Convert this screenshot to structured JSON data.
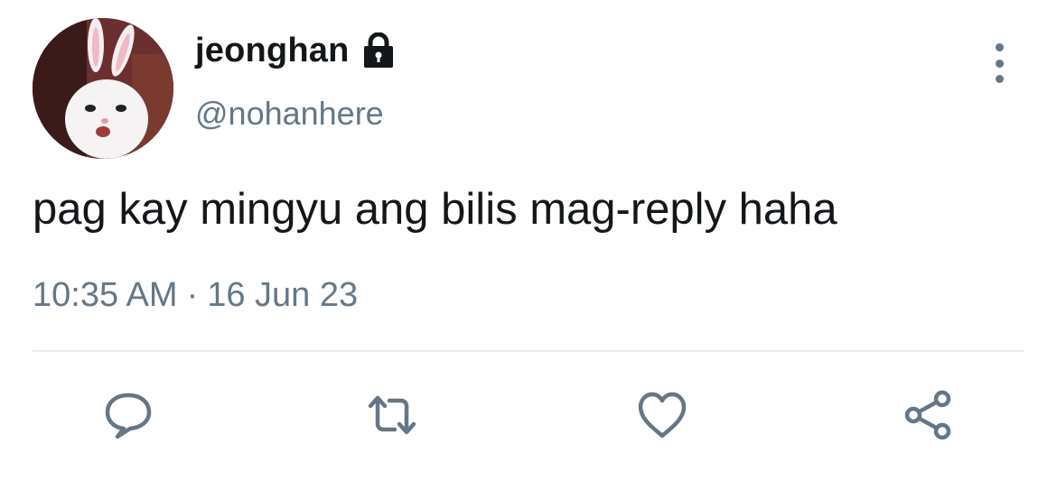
{
  "tweet": {
    "display_name": "jeonghan",
    "handle": "@nohanhere",
    "text": "pag kay mingyu ang bilis mag-reply haha",
    "time": "10:35 AM",
    "separator": "·",
    "date": "16 Jun 23",
    "protected": true
  },
  "icons": {
    "lock": "lock-icon",
    "more": "more-vertical-icon",
    "reply": "reply-icon",
    "retweet": "retweet-icon",
    "like": "heart-icon",
    "share": "share-icon"
  },
  "colors": {
    "text": "#14171a",
    "secondary": "#657786",
    "divider": "#e6ecf0"
  }
}
